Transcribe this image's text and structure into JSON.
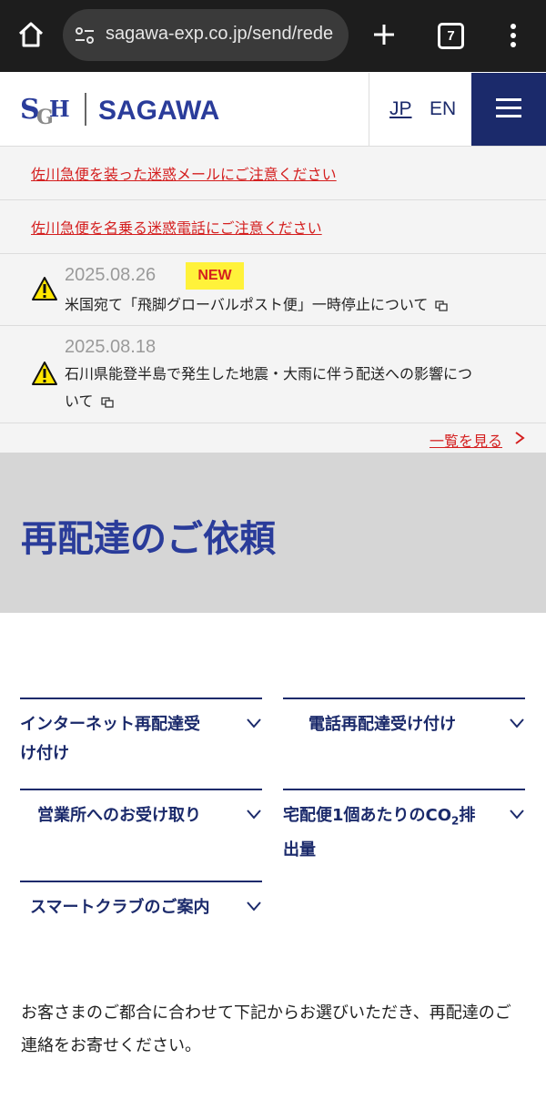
{
  "browser": {
    "url": "sagawa-exp.co.jp/send/rede",
    "tab_count": "7"
  },
  "header": {
    "brand": "SAGAWA",
    "logo_mark": "SGH",
    "lang_jp": "JP",
    "lang_en": "EN"
  },
  "alerts": [
    "佐川急便を装った迷惑メールにご注意ください",
    "佐川急便を名乗る迷惑電話にご注意ください"
  ],
  "news": [
    {
      "date": "2025.08.26",
      "badge": "NEW",
      "text": "米国宛て「飛脚グローバルポスト便」一時停止について"
    },
    {
      "date": "2025.08.18",
      "text_line1": "石川県能登半島で発生した地震・大雨に伴う配送への影響につ",
      "text_line2": "いて"
    }
  ],
  "more_link": "一覧を見る",
  "hero_title": "再配達のご依頼",
  "anchors": [
    {
      "line1": "インターネット再配達受",
      "line2": "け付け"
    },
    {
      "line1": "電話再配達受け付け"
    },
    {
      "line1": "営業所へのお受け取り"
    },
    {
      "line1_pre": "宅配便1個あたりのCO",
      "sub": "2",
      "line1_post": "排",
      "line2": "出量"
    },
    {
      "line1": "スマートクラブのご案内"
    }
  ],
  "intro_text": "お客さまのご都合に合わせて下記からお選びいただき、再配達のご連絡をお寄せください。",
  "colors": {
    "navy": "#1b2a6b",
    "hero_blue": "#2a3c9a",
    "alert_red": "#d41f1f",
    "badge_yellow": "#fff23a"
  }
}
